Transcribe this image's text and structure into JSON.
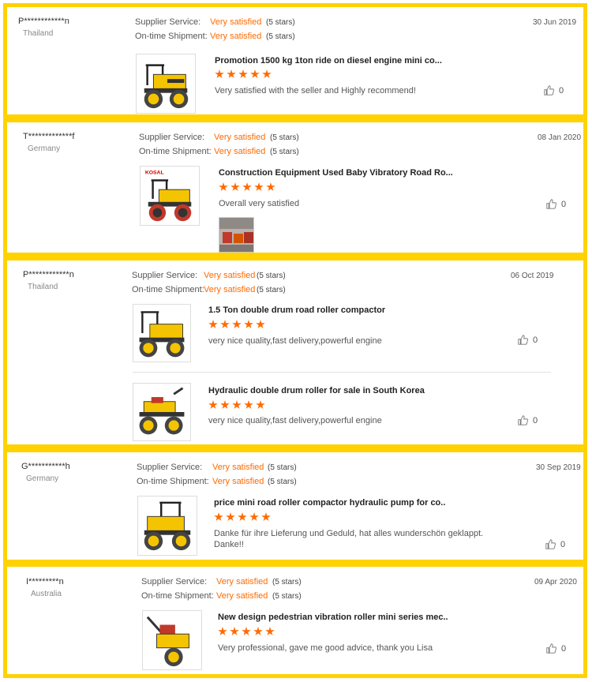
{
  "labels": {
    "supplier_service": "Supplier Service:",
    "ontime_shipment": "On-time Shipment:"
  },
  "reviews": [
    {
      "buyer": "P************n",
      "country": "Thailand",
      "supplier_rating": "Very satisfied",
      "supplier_stars": "(5 stars)",
      "shipment_rating": "Very satisfied",
      "shipment_stars": "(5 stars)",
      "date": "30 Jun 2019",
      "products": [
        {
          "title": "Promotion 1500 kg 1ton ride on diesel engine mini co...",
          "rating": 5,
          "comment": "Very satisfied with the seller and Highly recommend!",
          "likes": "0"
        }
      ]
    },
    {
      "buyer": "T*************f",
      "country": "Germany",
      "supplier_rating": "Very satisfied",
      "supplier_stars": "(5 stars)",
      "shipment_rating": "Very satisfied",
      "shipment_stars": "(5 stars)",
      "date": "08 Jan 2020",
      "products": [
        {
          "title": "Construction Equipment Used Baby Vibratory Road Ro...",
          "rating": 5,
          "comment": "Overall very satisfied",
          "likes": "0",
          "brand": "KOSAL"
        }
      ]
    },
    {
      "buyer": "P************n",
      "country": "Thailand",
      "supplier_rating": "Very satisfied",
      "supplier_stars": "(5 stars)",
      "shipment_rating": "Very satisfied",
      "shipment_stars": "(5 stars)",
      "date": "06 Oct 2019",
      "products": [
        {
          "title": "1.5 Ton double drum road roller compactor",
          "rating": 5,
          "comment": "very nice quality,fast delivery,powerful engine",
          "likes": "0"
        },
        {
          "title": "Hydraulic double drum roller for sale in South Korea",
          "rating": 5,
          "comment": "very nice quality,fast delivery,powerful engine",
          "likes": "0"
        }
      ]
    },
    {
      "buyer": "G***********h",
      "country": "Germany",
      "supplier_rating": "Very satisfied",
      "supplier_stars": "(5 stars)",
      "shipment_rating": "Very satisfied",
      "shipment_stars": "(5 stars)",
      "date": "30 Sep 2019",
      "products": [
        {
          "title": "price mini road roller compactor hydraulic pump for co..",
          "rating": 5,
          "comment_line1": "Danke für ihre Lieferung und Geduld, hat alles wunderschön geklappt.",
          "comment_line2": "Danke!!",
          "likes": "0"
        }
      ]
    },
    {
      "buyer": "I*********n",
      "country": "Australia",
      "supplier_rating": "Very satisfied",
      "supplier_stars": "(5 stars)",
      "shipment_rating": "Very satisfied",
      "shipment_stars": "(5 stars)",
      "date": "09 Apr 2020",
      "products": [
        {
          "title": "New design pedestrian vibration roller mini series mec..",
          "rating": 5,
          "comment": "Very professional, gave me good advice, thank you Lisa",
          "likes": "0"
        }
      ]
    }
  ],
  "icons": {
    "star": "star-icon",
    "like": "thumbs-up-icon",
    "product": "road-roller-image"
  },
  "colors": {
    "accent": "#FF6A00",
    "frame": "#FFD200",
    "machine": "#F5C400"
  }
}
